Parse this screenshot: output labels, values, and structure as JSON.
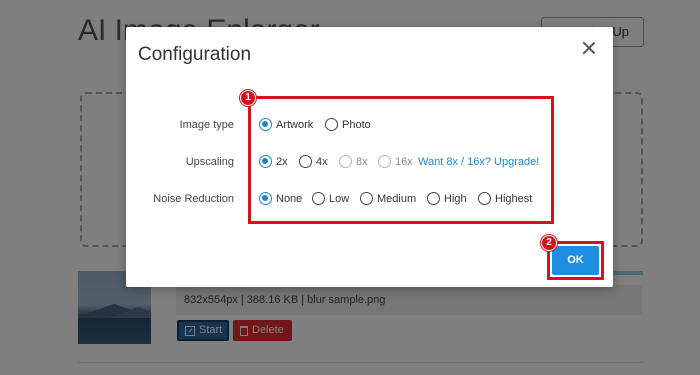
{
  "background": {
    "title": "AI Image Enlarger",
    "signup_label": "Sign Up",
    "file_info": "832x554px | 388.16 KB | blur sample.png",
    "start_label": "Start",
    "delete_label": "Delete"
  },
  "dialog": {
    "title": "Configuration",
    "image_type": {
      "label": "Image type",
      "options": [
        "Artwork",
        "Photo"
      ],
      "selected": "Artwork"
    },
    "upscaling": {
      "label": "Upscaling",
      "options": [
        "2x",
        "4x",
        "8x",
        "16x"
      ],
      "selected": "2x",
      "disabled": [
        "8x",
        "16x"
      ],
      "upgrade_link": "Want 8x / 16x? Upgrade!"
    },
    "noise_reduction": {
      "label": "Noise Reduction",
      "options": [
        "None",
        "Low",
        "Medium",
        "High",
        "Highest"
      ],
      "selected": "None"
    },
    "ok_label": "OK"
  },
  "annotations": {
    "badge_1": "1",
    "badge_2": "2",
    "highlight_color": "#d2141c"
  },
  "colors": {
    "accent": "#1e82c8",
    "ok_button": "#1e8fe0",
    "delete_button": "#e02f35",
    "start_button": "#2d6aa3"
  }
}
